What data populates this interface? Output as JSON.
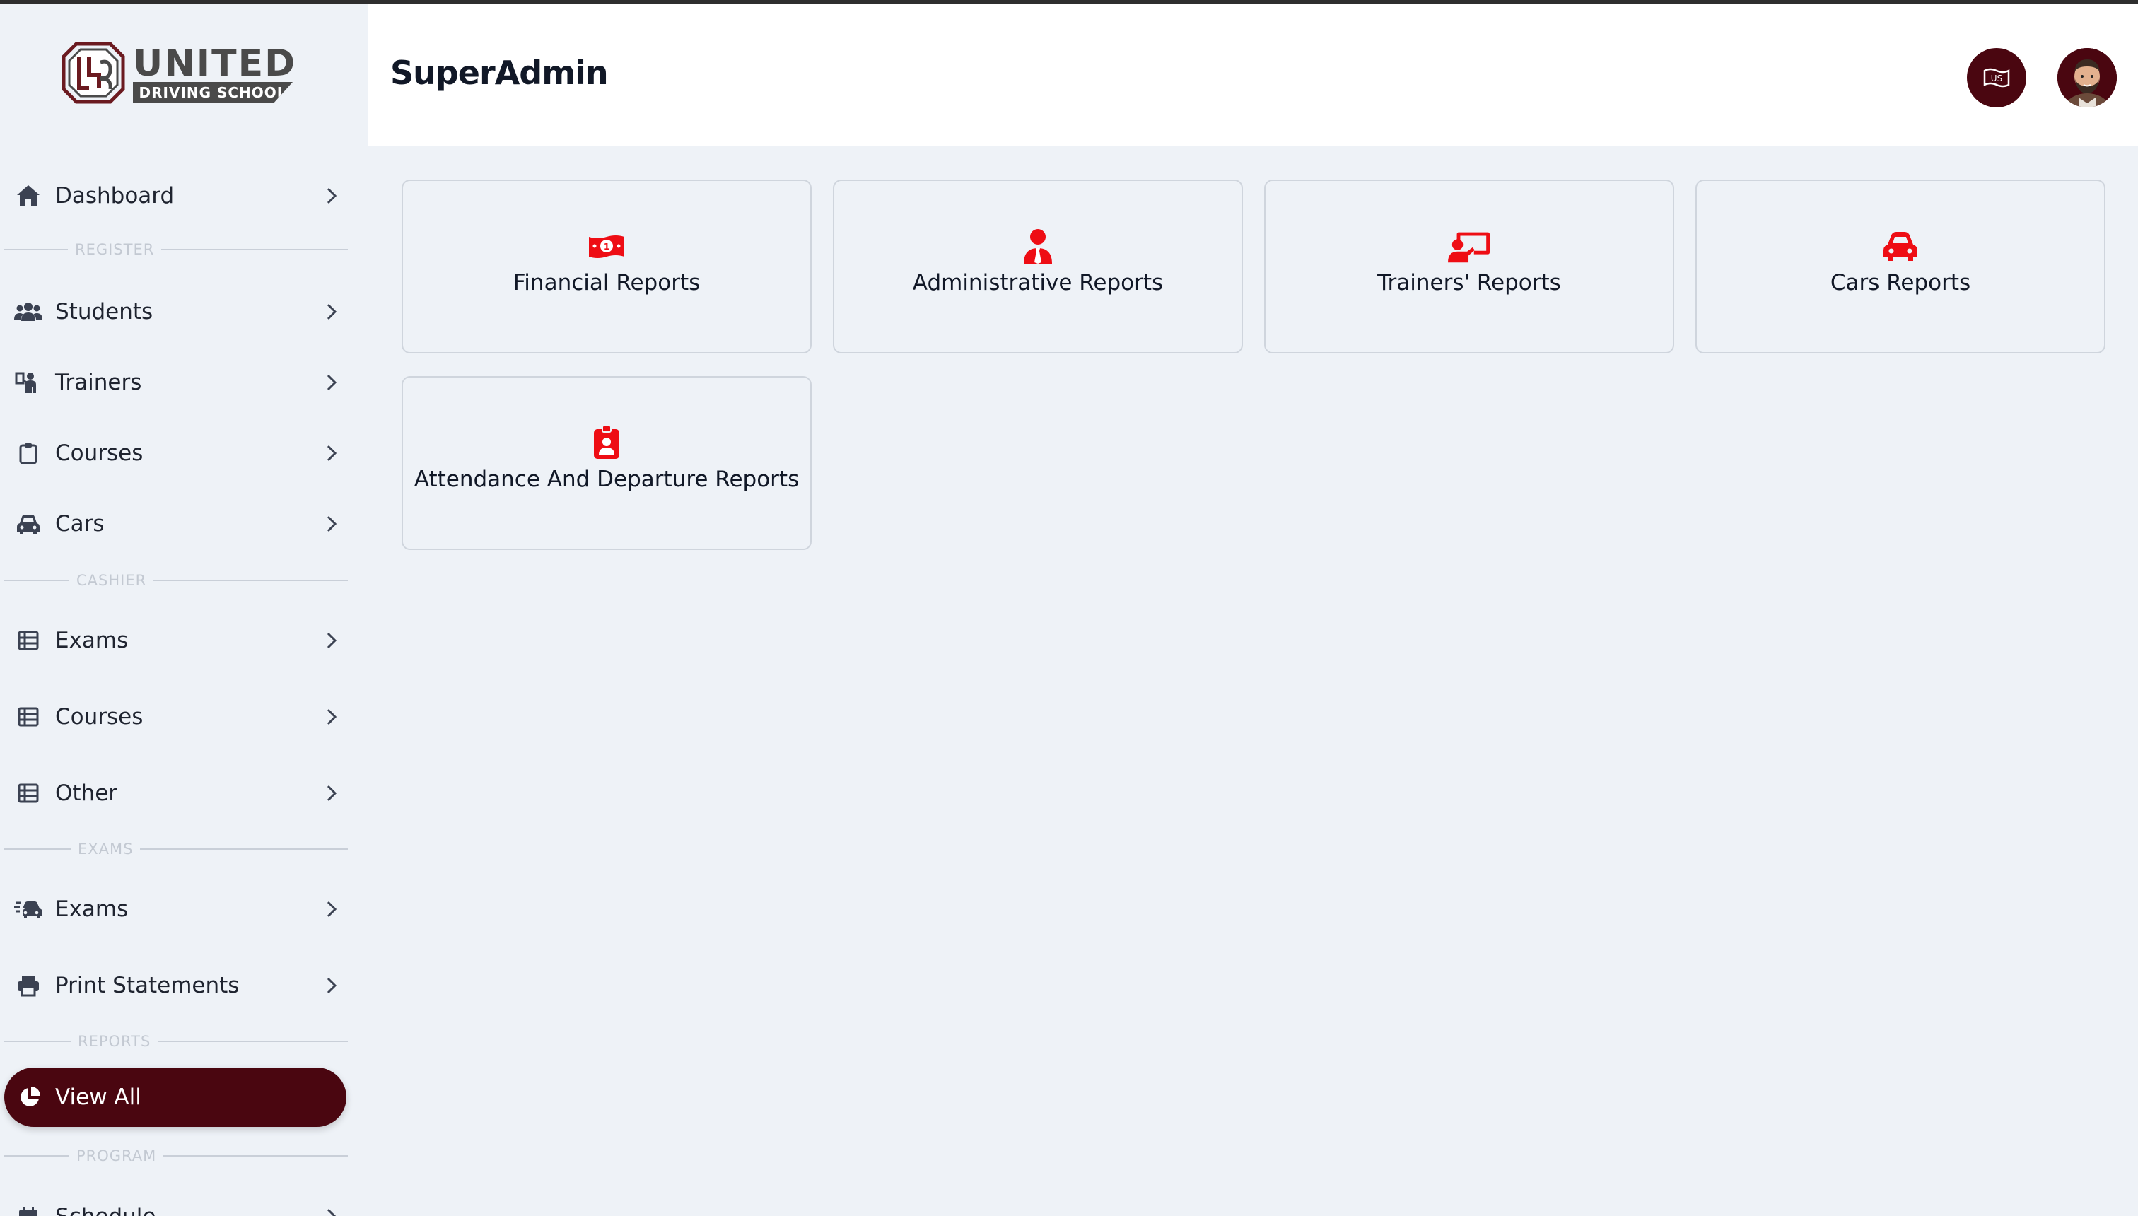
{
  "app": {
    "logo_title": "UNITED",
    "logo_subtitle": "DRIVING SCHOOL",
    "brand_color": "#4a0610",
    "accent_color": "#ee0d14"
  },
  "header": {
    "title": "SuperAdmin",
    "language_icon": "us-flag-icon",
    "avatar_icon": "user-avatar"
  },
  "sidebar": {
    "items": [
      {
        "label": "Dashboard",
        "icon": "home-icon"
      },
      {
        "label": "Students",
        "icon": "users-icon"
      },
      {
        "label": "Trainers",
        "icon": "trainer-icon"
      },
      {
        "label": "Courses",
        "icon": "clipboard-icon"
      },
      {
        "label": "Cars",
        "icon": "car-icon"
      },
      {
        "label": "Exams",
        "icon": "table-icon"
      },
      {
        "label": "Courses",
        "icon": "table-icon"
      },
      {
        "label": "Other",
        "icon": "table-icon"
      },
      {
        "label": "Exams",
        "icon": "car-exam-icon"
      },
      {
        "label": "Print Statements",
        "icon": "printer-icon"
      },
      {
        "label": "View All",
        "icon": "pie-chart-icon",
        "active": true
      },
      {
        "label": "Schedule",
        "icon": "calendar-icon"
      }
    ],
    "sections": {
      "register": "REGISTER",
      "cashier": "CASHIER",
      "exams": "EXAMS",
      "reports": "REPORTS",
      "program": "PROGRAM"
    }
  },
  "reports": [
    {
      "label": "Financial Reports",
      "icon": "money-bill-icon"
    },
    {
      "label": "Administrative Reports",
      "icon": "user-tie-icon"
    },
    {
      "label": "Trainers' Reports",
      "icon": "chalkboard-teacher-icon"
    },
    {
      "label": "Cars Reports",
      "icon": "car-icon"
    },
    {
      "label": "Attendance And Departure Reports",
      "icon": "id-badge-icon"
    }
  ]
}
